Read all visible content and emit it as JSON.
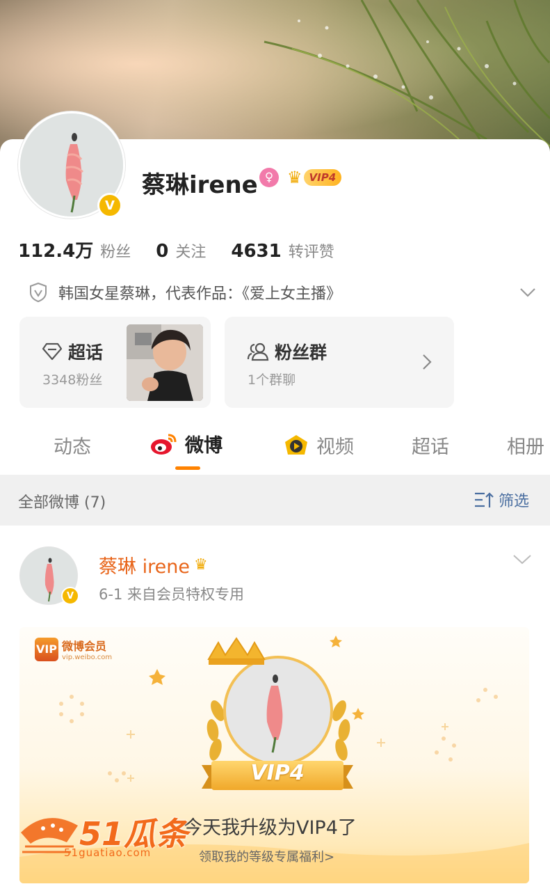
{
  "profile": {
    "name": "蔡琳irene",
    "vip_label": "VIP4",
    "verified_mark": "V",
    "gender_symbol": "♀",
    "stats": [
      {
        "value": "112.4万",
        "label": "粉丝"
      },
      {
        "value": "0",
        "label": "关注"
      },
      {
        "value": "4631",
        "label": "转评赞"
      }
    ],
    "bio": "韩国女星蔡琳，代表作品：《爱上女主播》"
  },
  "tiles": {
    "topic": {
      "title": "超话",
      "sub": "3348粉丝"
    },
    "fans": {
      "title": "粉丝群",
      "sub": "1个群聊"
    }
  },
  "tabs": [
    {
      "label": "动态",
      "active": false
    },
    {
      "label": "微博",
      "active": true
    },
    {
      "label": "视频",
      "active": false
    },
    {
      "label": "超话",
      "active": false
    },
    {
      "label": "相册",
      "active": false
    }
  ],
  "filter": {
    "all_label": "全部微博 (7)",
    "filter_label": "筛选"
  },
  "post": {
    "author": "蔡琳 irene",
    "meta": "6-1  来自会员特权专用",
    "banner": {
      "brand_title": "微博会员",
      "brand_url": "vip.weibo.com",
      "brand_mark": "VIP",
      "ribbon": "VIP4",
      "headline": "今天我升级为VIP4了",
      "link": "领取我的等级专属福利>"
    }
  },
  "watermark": {
    "text": "51瓜条",
    "url": "51guatiao.com"
  },
  "colors": {
    "accent": "#ff8200",
    "name_orange": "#e8651a",
    "link_blue": "#4a6ea0",
    "vip_gold": "#f5b800"
  }
}
